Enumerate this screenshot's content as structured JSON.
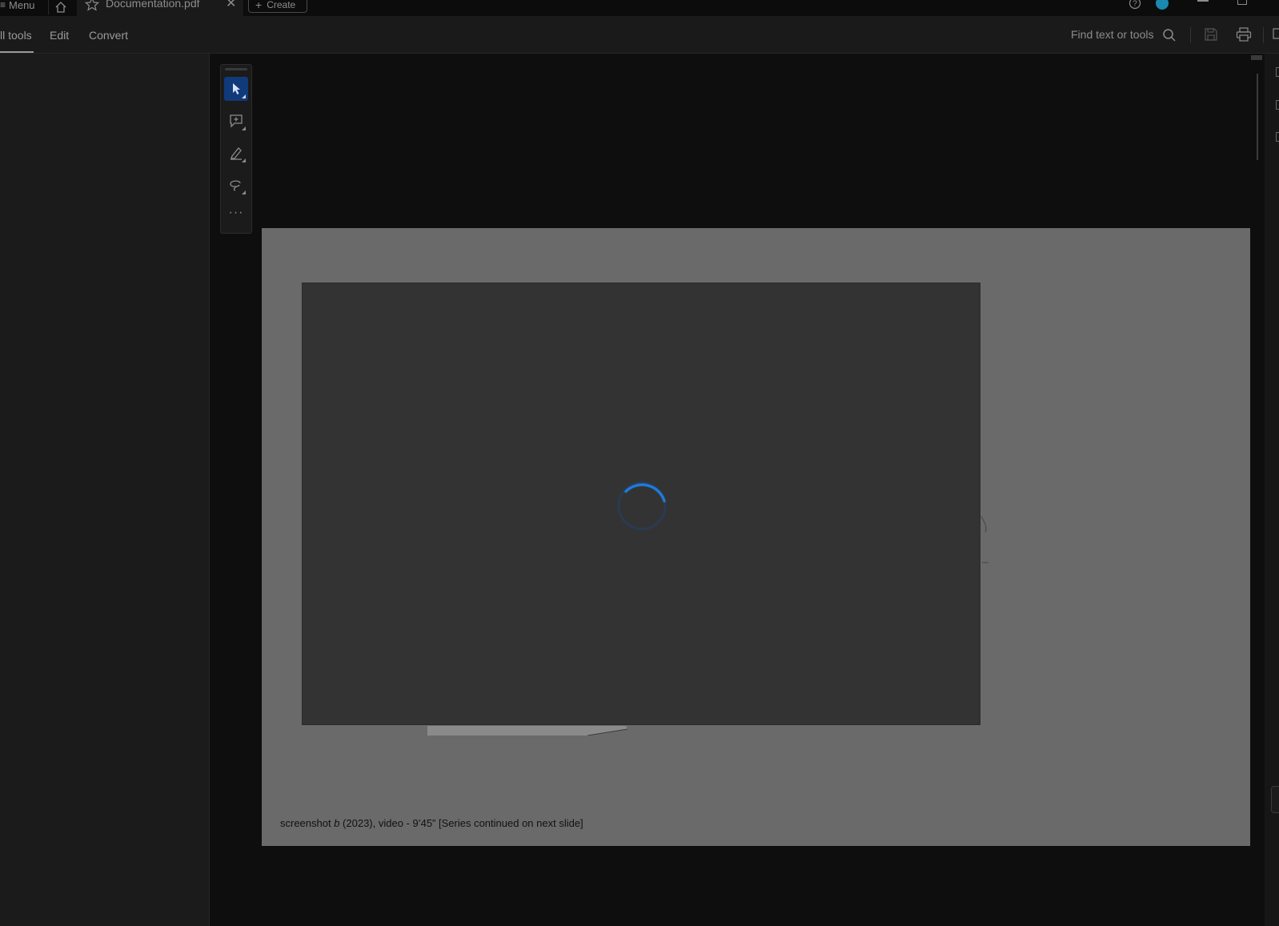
{
  "titlebar": {
    "menu_label": "Menu",
    "tab_title": "Documentation.pdf",
    "tab_close": "✕",
    "create_label": "Create",
    "create_plus": "+"
  },
  "menubar": {
    "items": [
      "ll tools",
      "Edit",
      "Convert"
    ],
    "find_label": "Find text or tools"
  },
  "toolrail": {
    "tools": [
      "select",
      "add-comment",
      "highlight",
      "draw",
      "more"
    ],
    "more_label": "···"
  },
  "page": {
    "caption_prefix": "screenshot ",
    "caption_italic": "b",
    "caption_suffix": " (2023), video - 9’45” [Series continued on next slide]"
  },
  "colors": {
    "accent": "#1f7ad8",
    "active_tool": "#103a7a",
    "avatar": "#1b88b0"
  }
}
